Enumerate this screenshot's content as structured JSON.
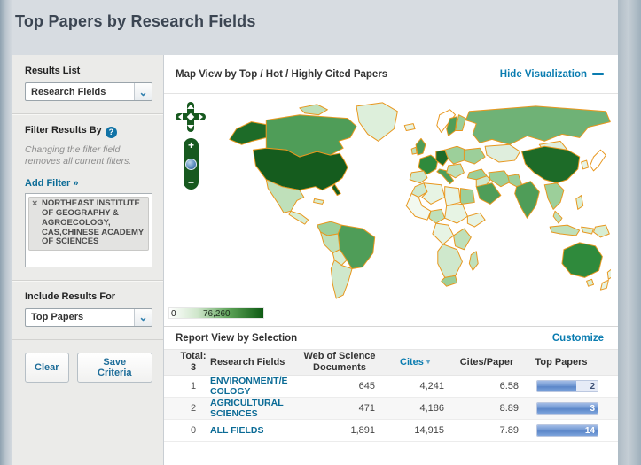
{
  "page": {
    "title": "Top Papers by Research Fields"
  },
  "sidebar": {
    "results_list": {
      "label": "Results List",
      "selected": "Research Fields"
    },
    "filter": {
      "label": "Filter Results By",
      "help_glyph": "?",
      "note": "Changing the filter field removes all current filters.",
      "add_filter": "Add Filter »",
      "chip": {
        "remove_glyph": "×",
        "text": "NORTHEAST INSTITUTE OF GEOGRAPHY & AGROECOLOGY, CAS,CHINESE ACADEMY OF SCIENCES"
      }
    },
    "include_results": {
      "label": "Include Results For",
      "selected": "Top Papers"
    },
    "buttons": {
      "clear": "Clear",
      "save": "Save Criteria"
    }
  },
  "map": {
    "title": "Map View by Top / Hot / Highly Cited Papers",
    "hide_link": "Hide Visualization",
    "controls": {
      "zoom_in": "+",
      "zoom_out": "−"
    },
    "legend": {
      "min": "0",
      "max": "76,260"
    },
    "colors": {
      "border": "#e8971e",
      "scale_low": "#ffffff",
      "scale_high": "#0e5a13",
      "control_green": "#17591f"
    }
  },
  "report": {
    "title": "Report View by Selection",
    "customize": "Customize",
    "total_label": "Total:",
    "total_value": "3",
    "columns": {
      "field": "Research Fields",
      "docs": "Web of Science Documents",
      "cites": "Cites",
      "cites_caret": "▾",
      "cites_per_paper": "Cites/Paper",
      "top_papers": "Top Papers"
    },
    "rows": [
      {
        "rank": "1",
        "field": "ENVIRONMENT/ECOLOGY",
        "docs": "645",
        "cites": "4,241",
        "cites_per_paper": "6.58",
        "top_papers": "2",
        "bar_fill_pct": 64
      },
      {
        "rank": "2",
        "field": "AGRICULTURAL SCIENCES",
        "docs": "471",
        "cites": "4,186",
        "cites_per_paper": "8.89",
        "top_papers": "3",
        "bar_fill_pct": 100
      },
      {
        "rank": "0",
        "field": "ALL FIELDS",
        "docs": "1,891",
        "cites": "14,915",
        "cites_per_paper": "7.89",
        "top_papers": "14",
        "bar_fill_pct": 100
      }
    ]
  }
}
